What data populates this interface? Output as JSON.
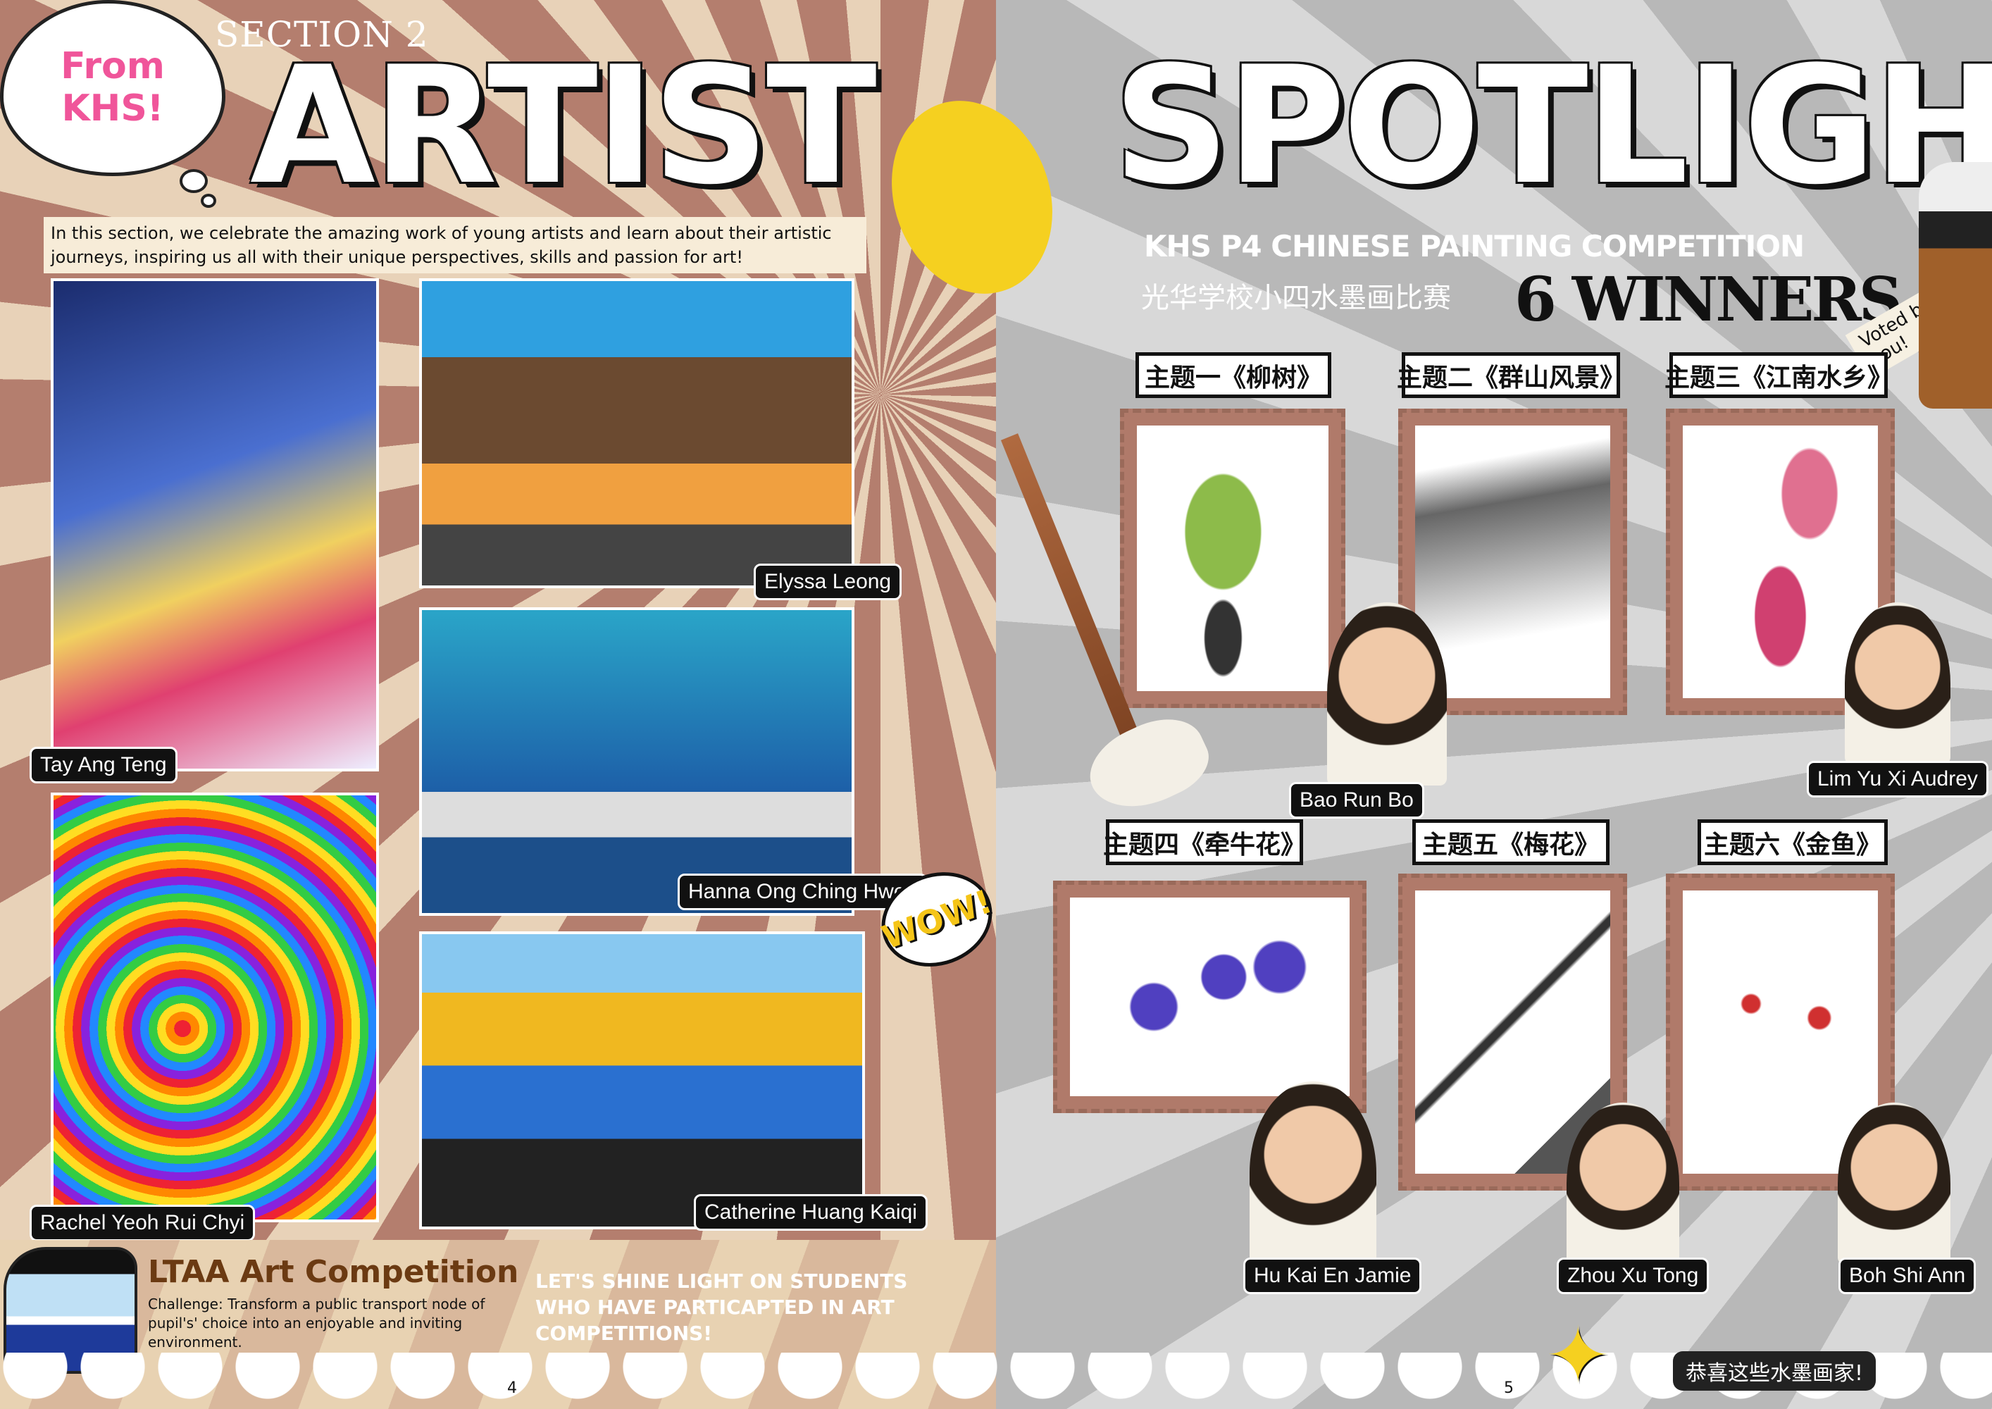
{
  "left_page": {
    "bubble_text": "From KHS!",
    "section_label": "SECTION 2",
    "title": "ARTIST",
    "intro": "In this section, we celebrate the amazing work of young artists and learn about their artistic journeys, inspiring us all with their unique perspectives, skills and passion for art!",
    "artworks": [
      {
        "artist": "Tay Ang Teng"
      },
      {
        "artist": "Elyssa Leong"
      },
      {
        "artist": "Hanna Ong Ching Hwee"
      },
      {
        "artist": "Rachel Yeoh Rui Chyi"
      },
      {
        "artist": "Catherine Huang Kaiqi"
      }
    ],
    "wow_sticker": "WOW!",
    "competition_title": "LTAA Art Competition",
    "competition_desc": "Challenge: Transform a public transport node of pupil's' choice into an enjoyable and inviting environment.",
    "shine_text": "LET'S SHINE LIGHT ON STUDENTS WHO HAVE PARTICAPTED IN ART COMPETITIONS!",
    "page_number": "4"
  },
  "right_page": {
    "title": "SPOTLIGHT",
    "subtitle": "KHS P4 CHINESE PAINTING COMPETITION",
    "subtitle_cn": "光华学校小四水墨画比赛",
    "winners_heading": "6 WINNERS",
    "voted_tag": "Voted by you!",
    "winners": [
      {
        "theme": "主题一《柳树》",
        "name": "Bao Run Bo"
      },
      {
        "theme": "主题二《群山风景》",
        "name": "Lim Yu Xi Audrey"
      },
      {
        "theme": "主题三《江南水乡》",
        "name": "Lim Yu Xi Audrey"
      },
      {
        "theme": "主题四《牵牛花》",
        "name": "Hu Kai En Jamie"
      },
      {
        "theme": "主题五《梅花》",
        "name": "Zhou Xu Tong"
      },
      {
        "theme": "主题六《金鱼》",
        "name": "Boh Shi Ann"
      }
    ],
    "congrats": "恭喜这些水墨画家!",
    "page_number": "5"
  },
  "colors": {
    "left_bg": "#b47e6e",
    "right_bg": "#c8c8c8",
    "pink": "#f0559a",
    "brown_title": "#6b3a12"
  }
}
